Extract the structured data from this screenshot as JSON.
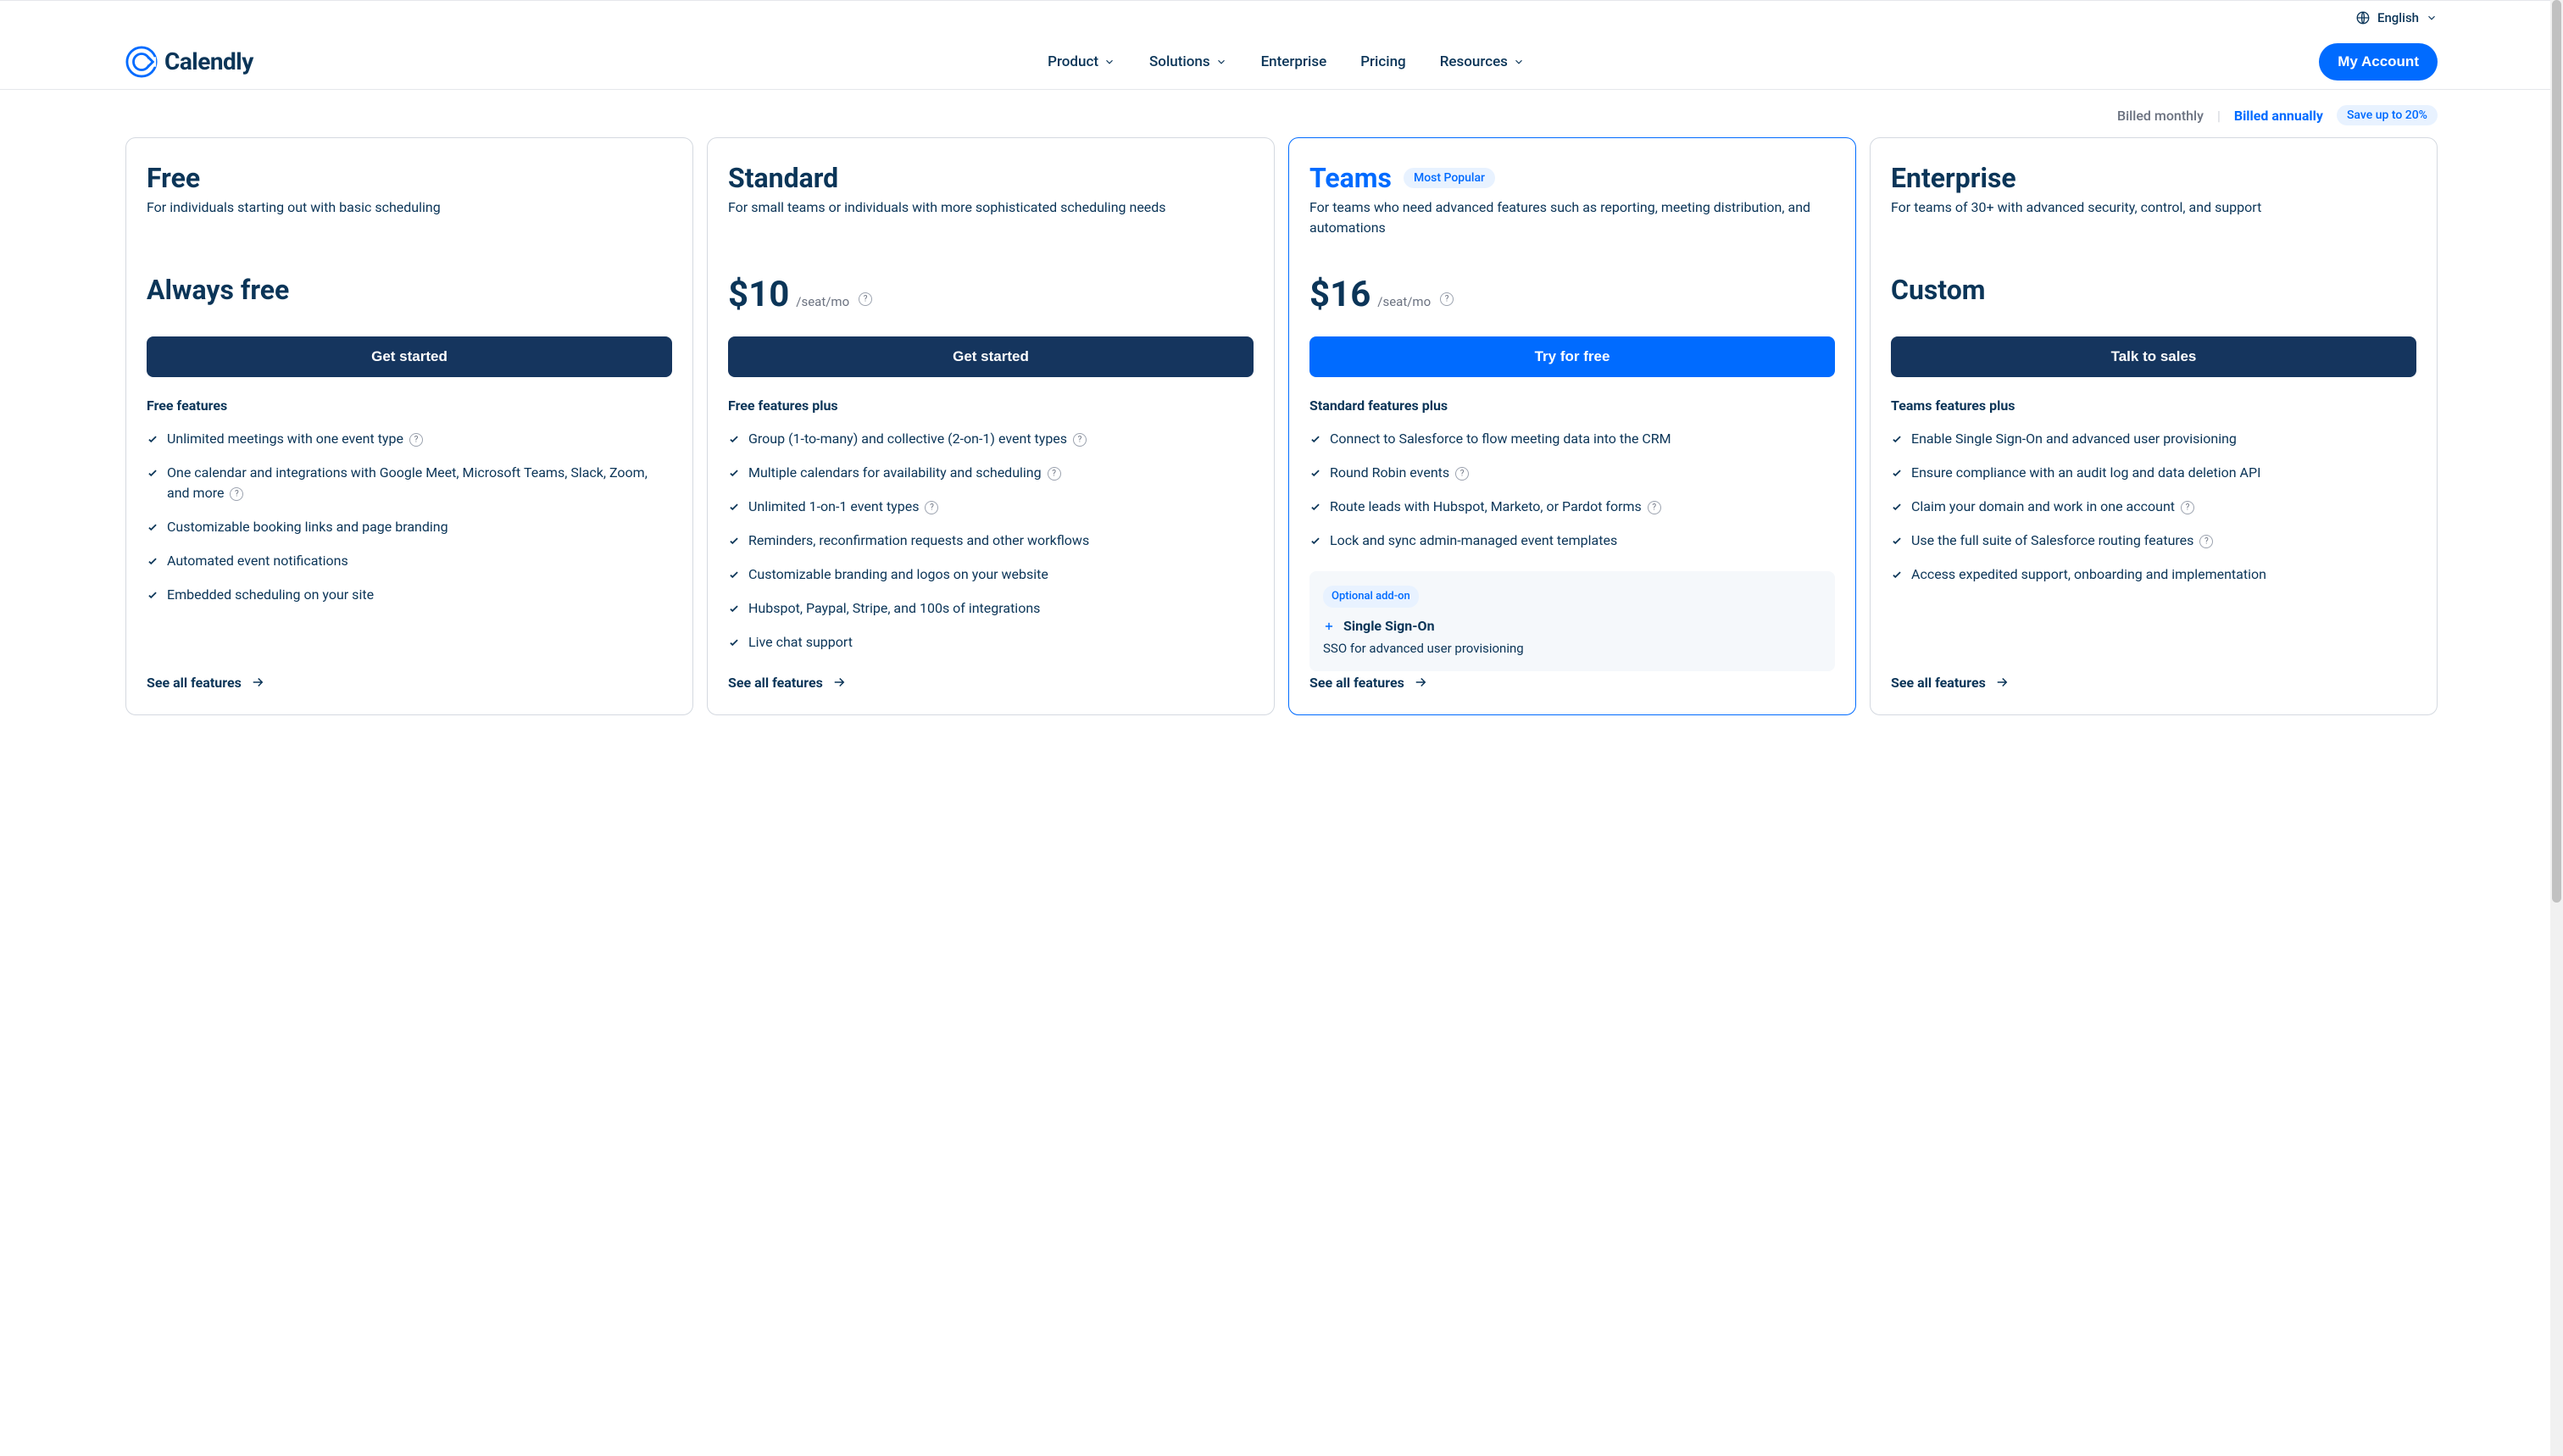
{
  "topbar": {
    "language": "English"
  },
  "nav": {
    "brand": "Calendly",
    "links": {
      "product": "Product",
      "solutions": "Solutions",
      "enterprise": "Enterprise",
      "pricing": "Pricing",
      "resources": "Resources"
    },
    "account_btn": "My Account"
  },
  "billing": {
    "monthly": "Billed monthly",
    "annual": "Billed annually",
    "save": "Save up to 20%"
  },
  "plans": {
    "free": {
      "title": "Free",
      "desc": "For individuals starting out with basic scheduling",
      "price_text": "Always free",
      "cta": "Get started",
      "features_heading": "Free features",
      "f1": "Unlimited meetings with one event type",
      "f2": "One calendar and integrations with Google Meet, Microsoft Teams, Slack, Zoom, and more",
      "f3": "Customizable booking links and page branding",
      "f4": "Automated event notifications",
      "f5": "Embedded scheduling on your site",
      "see_all": "See all features"
    },
    "standard": {
      "title": "Standard",
      "desc": "For small teams or individuals with more sophisticated scheduling needs",
      "price": "$10",
      "unit": "/seat/mo",
      "cta": "Get started",
      "features_heading": "Free features plus",
      "f1": "Group (1-to-many) and collective (2-on-1) event types",
      "f2": "Multiple calendars for availability and scheduling",
      "f3": "Unlimited 1-on-1 event types",
      "f4": "Reminders, reconfirmation requests and other workflows",
      "f5": "Customizable branding and logos on your website",
      "f6": "Hubspot, Paypal, Stripe, and 100s of integrations",
      "f7": "Live chat support",
      "see_all": "See all features"
    },
    "teams": {
      "title": "Teams",
      "badge": "Most Popular",
      "desc": "For teams who need advanced features such as reporting, meeting distribution, and automations",
      "price": "$16",
      "unit": "/seat/mo",
      "cta": "Try for free",
      "features_heading": "Standard features plus",
      "f1": "Connect to Salesforce to flow meeting data into the CRM",
      "f2": "Round Robin events",
      "f3": "Route leads with Hubspot, Marketo, or Pardot forms",
      "f4": "Lock and sync admin-managed event templates",
      "addon_label": "Optional add-on",
      "addon_title": "Single Sign-On",
      "addon_desc": "SSO for advanced user provisioning",
      "see_all": "See all features"
    },
    "enterprise": {
      "title": "Enterprise",
      "desc": "For teams of 30+ with advanced security, control, and support",
      "price_text": "Custom",
      "cta": "Talk to sales",
      "features_heading": "Teams features plus",
      "f1": "Enable Single Sign-On and advanced user provisioning",
      "f2": "Ensure compliance with an audit log and data deletion API",
      "f3": "Claim your domain and work in one account",
      "f4": "Use the full suite of Salesforce routing features",
      "f5": "Access expedited support, onboarding and implementation",
      "see_all": "See all features"
    }
  }
}
